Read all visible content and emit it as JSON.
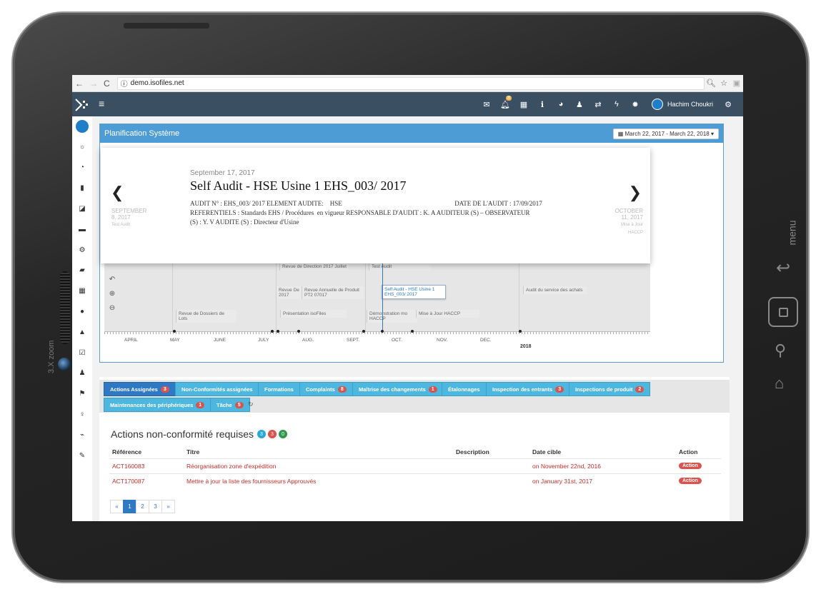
{
  "device": {
    "zoom_label": "3.X zoom",
    "menu_label": "menu"
  },
  "browser": {
    "url": "demo.isofiles.net"
  },
  "topbar": {
    "user_name": "Hachim Choukri",
    "notification_count": "8"
  },
  "panel": {
    "title": "Planification Système",
    "date_range": "March 22, 2017 - March 22, 2018 ▾"
  },
  "event": {
    "date": "September 17, 2017",
    "title": "Self Audit - HSE Usine 1 EHS_003/ 2017",
    "body": "AUDIT N° : EHS_003/ 2017 ELEMENT AUDITE:    HSE                                                                      DATE DE L'AUDIT : 17/09/2017\nREFERENTIELS : Standards EHS / Procédures  en vigueur RESPONSABLE D'AUDIT : K. A AUDITEUR (S) – OBSERVATEUR\n(S) : Y. V AUDITE (S) : Directeur d'Usine",
    "prev_date": "SEPTEMBER\n8, 2017",
    "prev_label": "Test Audit",
    "next_date": "OCTOBER\n11, 2017",
    "next_label": "Mise à Jour\nHACCP"
  },
  "timeline": {
    "items": [
      "Revue de Direction 2017 Juillet",
      "Test Audit",
      "Revue De 2017",
      "Revue Annuelle de Produit PT2 07017",
      "Self Audit - HSE Usine 1 EHS_003/ 2017",
      "Audit du service des achats",
      "Revue de Dossiers de Lots",
      "Présentation isoFiles",
      "Démonstration mo HACCP",
      "Mise à Jour HACCP"
    ],
    "months": [
      "APRIL",
      "MAY",
      "JUNE",
      "JULY",
      "AUG.",
      "SEPT.",
      "OCT.",
      "NOV.",
      "DEC."
    ],
    "year": "2018"
  },
  "tabs": [
    {
      "label": "Actions Assignées",
      "badge": "3"
    },
    {
      "label": "Non-Conformités assignées",
      "badge": ""
    },
    {
      "label": "Formations",
      "badge": ""
    },
    {
      "label": "Complaints",
      "badge": "8"
    },
    {
      "label": "Maîtrise des changements",
      "badge": "1"
    },
    {
      "label": "Étalonnages",
      "badge": ""
    },
    {
      "label": "Inspection des entrants",
      "badge": "3"
    },
    {
      "label": "Inspections de produit",
      "badge": "2"
    },
    {
      "label": "Maintenances des périphériques",
      "badge": "1"
    },
    {
      "label": "Tâche",
      "badge": "5"
    }
  ],
  "section": {
    "title": "Actions non-conformité requises",
    "counts": [
      "3",
      "3",
      "0"
    ],
    "count_colors": [
      "#2aa9d6",
      "#d9534f",
      "#2e9a4a"
    ]
  },
  "table": {
    "headers": [
      "Référence",
      "Titre",
      "Description",
      "Date cible",
      "Action"
    ],
    "rows": [
      {
        "ref": "ACT160083",
        "title": "Réorganisation zone d'expédition",
        "description": "",
        "date": "on November 22nd, 2016",
        "action": "Action"
      },
      {
        "ref": "ACT170087",
        "title": "Mettre à jour la liste des fournisseurs Approuvés",
        "description": "",
        "date": "on January 31st, 2017",
        "action": "Action"
      }
    ]
  },
  "pagination": [
    "«",
    "1",
    "2",
    "3",
    "»"
  ]
}
